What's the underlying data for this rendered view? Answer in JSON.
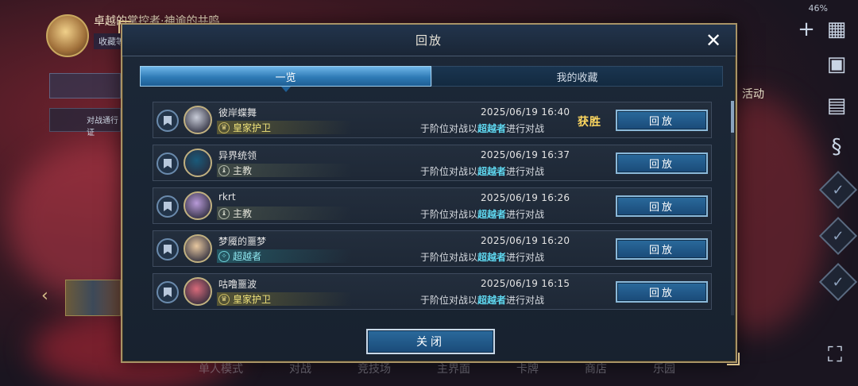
{
  "background": {
    "top_name": "卓越的掌控者·神谕的共鸣",
    "top_sub": "收藏等",
    "side_menu_2": "对战通行证",
    "battery": "46%",
    "activity_label": "活动",
    "bottom_nav": [
      "单人模式",
      "对战",
      "竞技场",
      "主界面",
      "卡牌",
      "商店",
      "乐园"
    ]
  },
  "dialog": {
    "title": "回放",
    "tabs": [
      {
        "label": "一览",
        "active": true
      },
      {
        "label": "我的收藏",
        "active": false
      }
    ],
    "close_label": "关闭",
    "replay_label": "回放",
    "victory_label": "获胜",
    "desc_prefix": "于阶位对战以",
    "desc_suffix": "进行对战"
  },
  "matches": [
    {
      "player": "彼岸蝶舞",
      "rank": "皇家护卫",
      "rank_style": "gold",
      "rank_icon": "crown-icon",
      "date": "2025/06/19  16:40",
      "class": "超越者",
      "victory": true,
      "avatar_color": "#c8ccd8"
    },
    {
      "player": "异界统领",
      "rank": "主教",
      "rank_style": "gray",
      "rank_icon": "bishop-icon",
      "date": "2025/06/19  16:37",
      "class": "超越者",
      "victory": false,
      "avatar_color": "#1a5a7a"
    },
    {
      "player": "rkrt",
      "rank": "主教",
      "rank_style": "gray",
      "rank_icon": "bishop-icon",
      "date": "2025/06/19  16:26",
      "class": "超越者",
      "victory": false,
      "avatar_color": "#b89ad8"
    },
    {
      "player": "梦魇的噩梦",
      "rank": "超越者",
      "rank_style": "teal",
      "rank_icon": "transcend-icon",
      "date": "2025/06/19  16:20",
      "class": "超越者",
      "victory": false,
      "avatar_color": "#e8c8a0"
    },
    {
      "player": "咕噜噩波",
      "rank": "皇家护卫",
      "rank_style": "gold",
      "rank_icon": "crown-icon",
      "date": "2025/06/19  16:15",
      "class": "超越者",
      "victory": false,
      "avatar_color": "#d86a7a"
    }
  ]
}
